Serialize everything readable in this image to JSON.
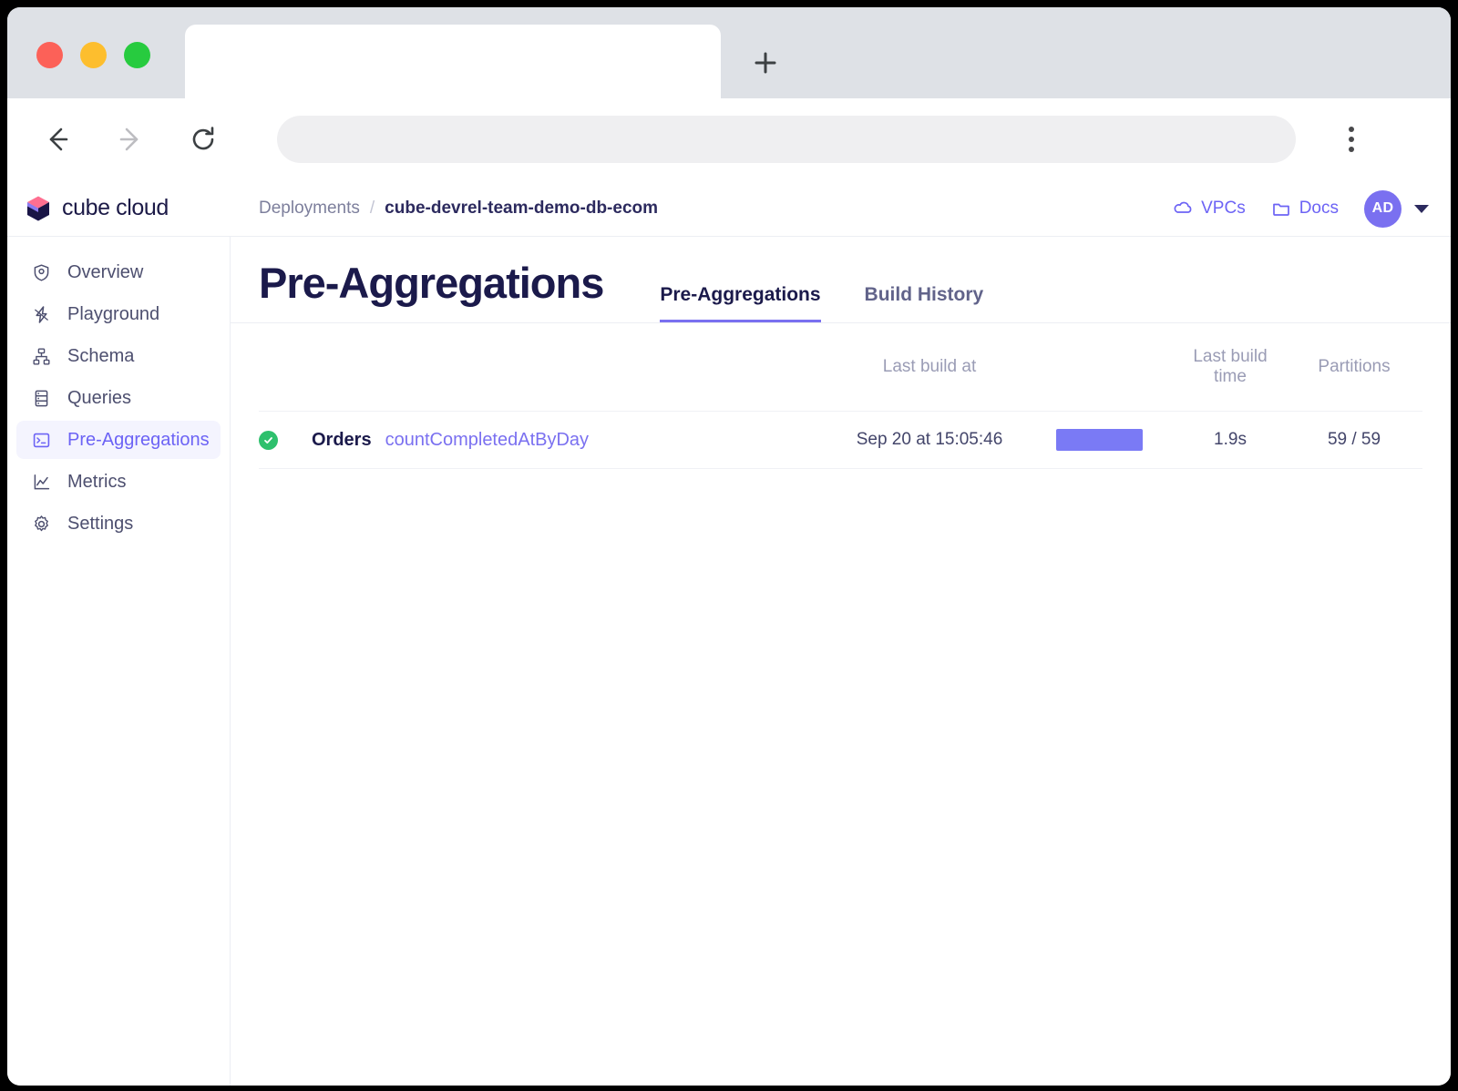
{
  "browser": {
    "tab_title": "",
    "url": "",
    "url_placeholder": "",
    "new_tab_label": "+",
    "nav": {
      "back": "back-arrow",
      "forward": "forward-arrow",
      "reload": "reload-icon",
      "menu": "three-dot-menu"
    }
  },
  "app": {
    "brand": {
      "logo": "cube-logo-icon",
      "name": "cube cloud"
    },
    "breadcrumb": {
      "root": "Deployments",
      "separator": "/",
      "current": "cube-devrel-team-demo-db-ecom"
    },
    "header_links": [
      {
        "icon": "cloud-icon",
        "label": "VPCs"
      },
      {
        "icon": "folder-icon",
        "label": "Docs"
      }
    ],
    "avatar": {
      "initials": "AD",
      "caret": "chevron-down-icon"
    },
    "sidebar": {
      "items": [
        {
          "label": "Overview",
          "icon": "shield-icon",
          "active": false
        },
        {
          "label": "Playground",
          "icon": "bolt-icon",
          "active": false
        },
        {
          "label": "Schema",
          "icon": "sitemap-icon",
          "active": false
        },
        {
          "label": "Queries",
          "icon": "database-icon",
          "active": false
        },
        {
          "label": "Pre-Aggregations",
          "icon": "terminal-icon",
          "active": true
        },
        {
          "label": "Metrics",
          "icon": "line-chart-icon",
          "active": false
        },
        {
          "label": "Settings",
          "icon": "gear-icon",
          "active": false
        }
      ]
    },
    "page": {
      "title": "Pre-Aggregations",
      "tabs": [
        {
          "label": "Pre-Aggregations",
          "active": true
        },
        {
          "label": "Build History",
          "active": false
        }
      ]
    },
    "table": {
      "columns": {
        "status": "",
        "name": "",
        "last_build_at": "Last build at",
        "build_bar": "",
        "last_build_time": "Last build time",
        "partitions": "Partitions"
      },
      "rows": [
        {
          "status": "success",
          "cube": "Orders",
          "pre_aggregation": "countCompletedAtByDay",
          "last_build_at": "Sep 20 at 15:05:46",
          "bar_width_pct": 57,
          "last_build_time": "1.9s",
          "partitions": "59 / 59"
        }
      ]
    }
  },
  "colors": {
    "accent": "#7a70f0",
    "accent_link": "#6c63f5",
    "bar": "#7a7af5",
    "status_success": "#2ec06d",
    "title": "#1b1a4b",
    "muted": "#9a9cb5"
  }
}
